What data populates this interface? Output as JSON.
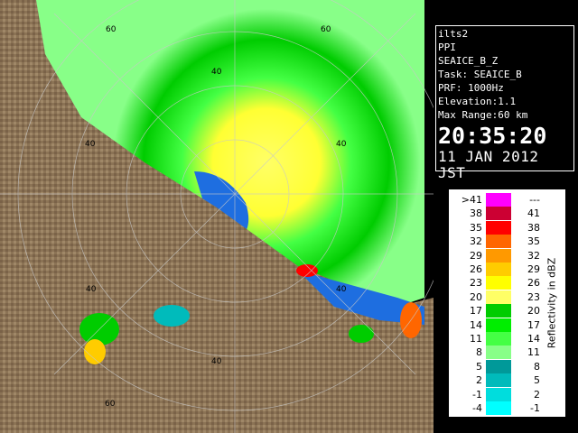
{
  "info": {
    "lines": [
      "ilts2",
      "PPI",
      "SEAICE_B_Z",
      "Task: SEAICE_B",
      "PRF: 1000Hz",
      "Elevation:1.1",
      "Max Range:60 km"
    ],
    "time": "20:35:20",
    "date": "11 JAN 2012 JST"
  },
  "scale": {
    "title": "Reflectivity in dBZ",
    "rows": [
      {
        "lo": ">41",
        "hi": "---",
        "color": "#ff00ff"
      },
      {
        "lo": "38",
        "hi": "41",
        "color": "#cc0033"
      },
      {
        "lo": "35",
        "hi": "38",
        "color": "#ff0000"
      },
      {
        "lo": "32",
        "hi": "35",
        "color": "#ff6600"
      },
      {
        "lo": "29",
        "hi": "32",
        "color": "#ff9900"
      },
      {
        "lo": "26",
        "hi": "29",
        "color": "#ffcc00"
      },
      {
        "lo": "23",
        "hi": "26",
        "color": "#ffff00"
      },
      {
        "lo": "20",
        "hi": "23",
        "color": "#ffff66"
      },
      {
        "lo": "17",
        "hi": "20",
        "color": "#00cc00"
      },
      {
        "lo": "14",
        "hi": "17",
        "color": "#00ee00"
      },
      {
        "lo": "11",
        "hi": "14",
        "color": "#44ff44"
      },
      {
        "lo": "8",
        "hi": "11",
        "color": "#88ff88"
      },
      {
        "lo": "5",
        "hi": "8",
        "color": "#009999"
      },
      {
        "lo": "2",
        "hi": "5",
        "color": "#00bbbb"
      },
      {
        "lo": "-1",
        "hi": "2",
        "color": "#00dddd"
      },
      {
        "lo": "-4",
        "hi": "-1",
        "color": "#00ffff"
      }
    ]
  },
  "range_labels": [
    "60",
    "40",
    "60",
    "40",
    "40",
    "40",
    "40",
    "40",
    "60"
  ],
  "colors": {
    "land": "#8b7355",
    "sea": "#1e6ee0",
    "ring": "#c8c8c8"
  }
}
